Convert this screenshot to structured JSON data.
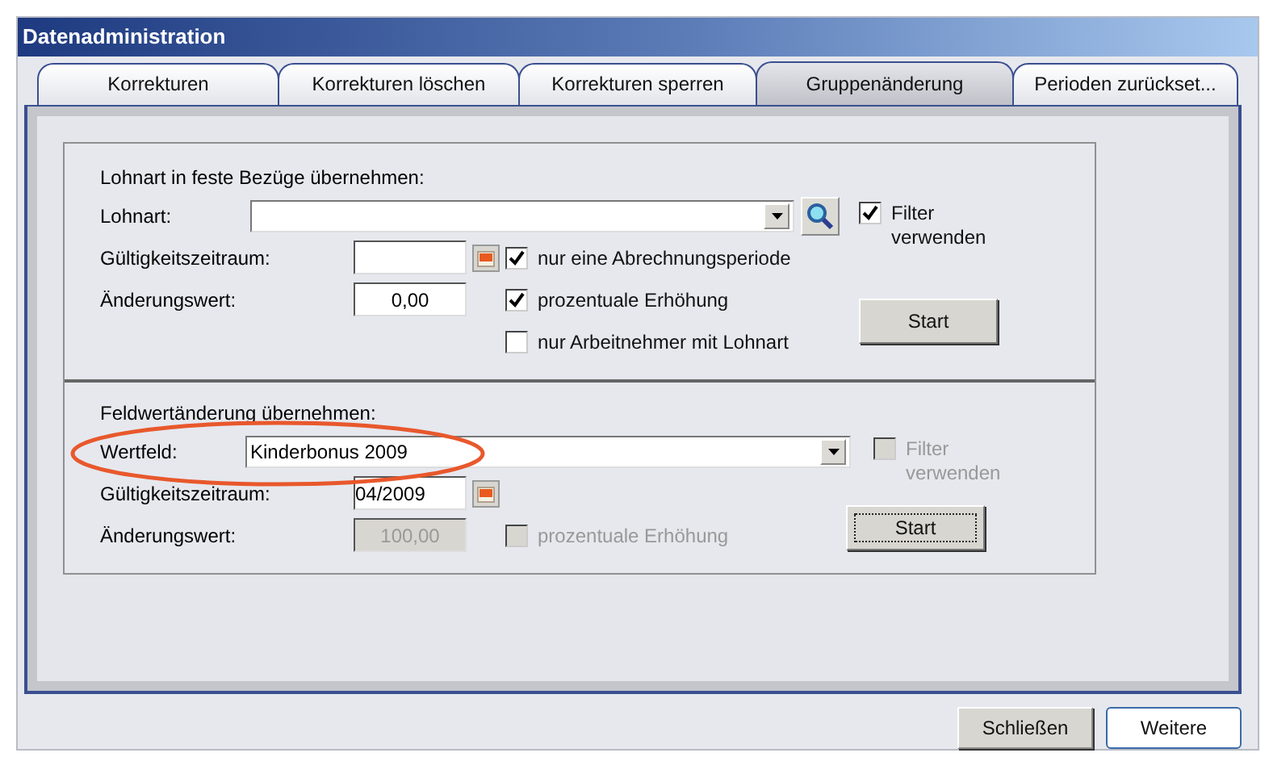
{
  "window": {
    "title": "Datenadministration"
  },
  "tabs": [
    {
      "label": "Korrekturen",
      "selected": false
    },
    {
      "label": "Korrekturen löschen",
      "selected": false
    },
    {
      "label": "Korrekturen sperren",
      "selected": false
    },
    {
      "label": "Gruppenänderung",
      "selected": true
    },
    {
      "label": "Perioden zurückset...",
      "selected": false
    }
  ],
  "sections": [
    {
      "heading": "Lohnart in feste Bezüge übernehmen:",
      "main": {
        "label": "Lohnart:",
        "search": true,
        "circled": false
      },
      "period": {
        "label": "Gültigkeitszeitraum:"
      },
      "change": {
        "label": "Änderungswert:",
        "value": "0,00",
        "disabled": false
      },
      "checkboxes": [
        {
          "label": "nur eine Abrechnungsperiode",
          "checked": true,
          "disabled": false
        },
        {
          "label": "prozentuale Erhöhung",
          "checked": true,
          "disabled": false
        },
        {
          "label": "nur Arbeitnehmer mit Lohnart",
          "checked": false,
          "disabled": false
        }
      ],
      "filter": {
        "label": "Filter verwenden",
        "checked": true,
        "disabled": false
      },
      "start": {
        "label": "Start",
        "focused": false
      }
    },
    {
      "heading": "Feldwertänderung übernehmen:",
      "main": {
        "label": "Wertfeld:",
        "value": "Kinderbonus 2009",
        "search": false,
        "circled": true
      },
      "period": {
        "label": "Gültigkeitszeitraum:",
        "value": "04/2009"
      },
      "change": {
        "label": "Änderungswert:",
        "value": "100,00",
        "disabled": true
      },
      "checkboxes": [
        {
          "label": "prozentuale Erhöhung",
          "checked": false,
          "disabled": true
        }
      ],
      "filter": {
        "label": "Filter verwenden",
        "checked": false,
        "disabled": true
      },
      "start": {
        "label": "Start",
        "focused": true
      }
    }
  ],
  "buttons": [
    {
      "label": "Schließen",
      "default": false
    },
    {
      "label": "Weitere",
      "default": true
    }
  ]
}
